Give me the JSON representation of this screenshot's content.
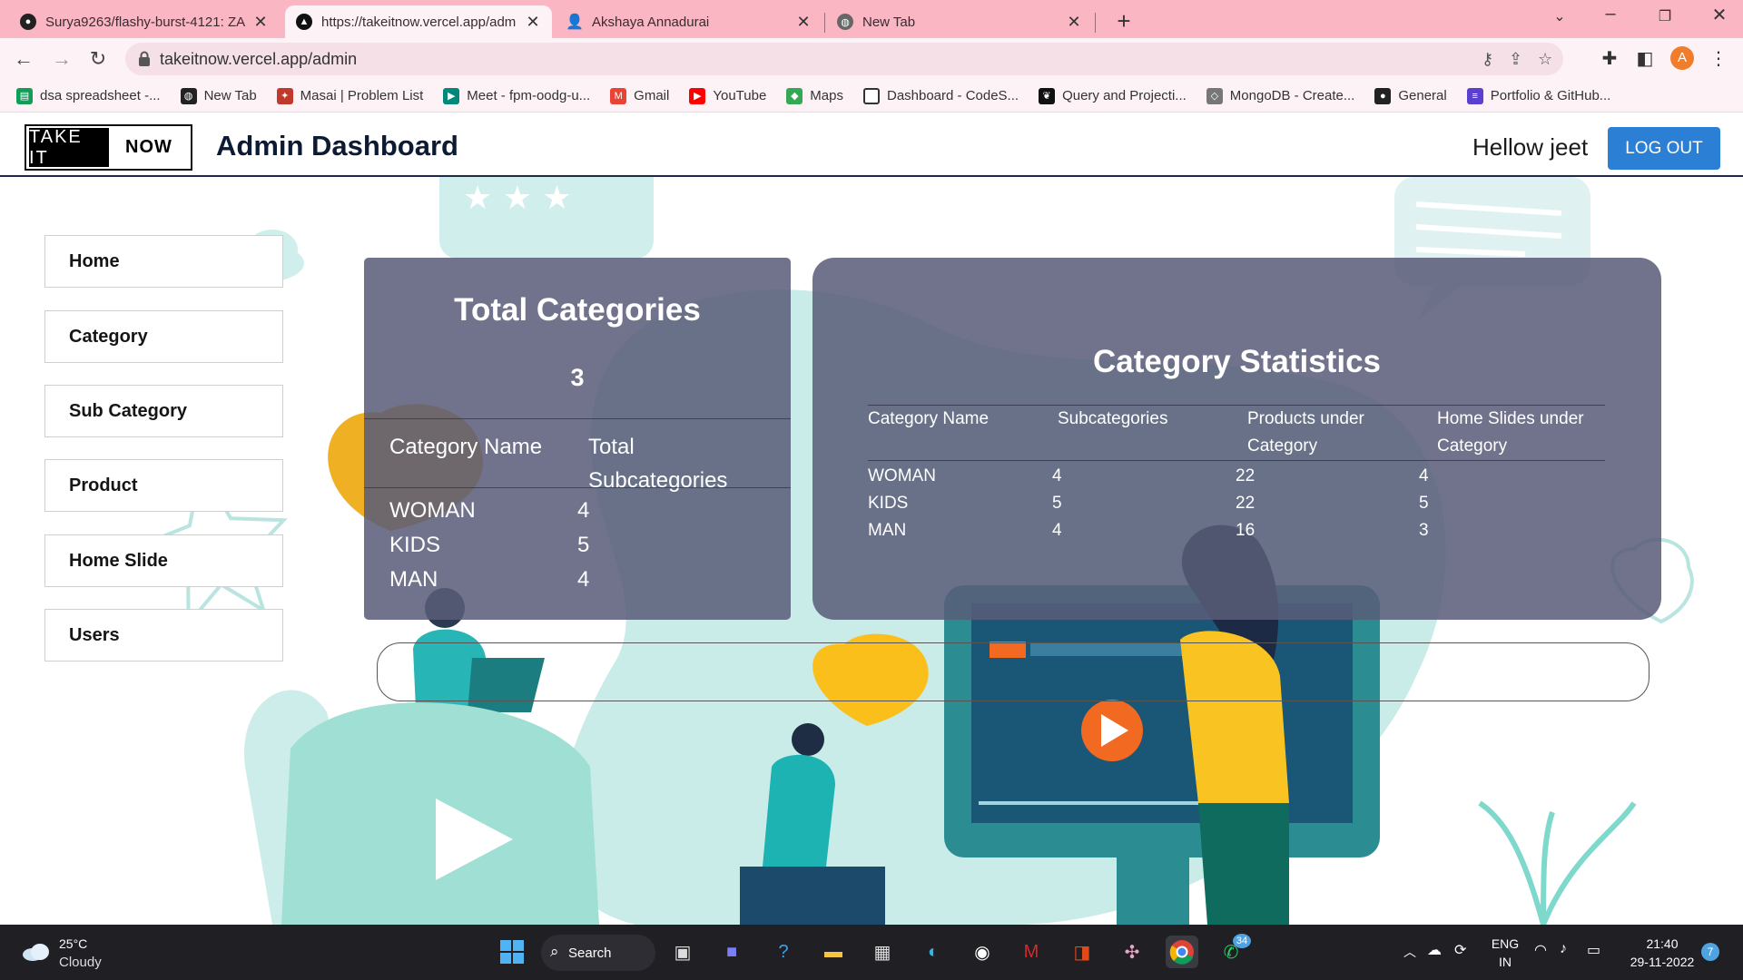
{
  "browser": {
    "tabs": [
      {
        "title": "Surya9263/flashy-burst-4121: ZA",
        "icon": "github-icon",
        "active": false
      },
      {
        "title": "https://takeitnow.vercel.app/adm",
        "icon": "vercel-icon",
        "active": true
      },
      {
        "title": "Akshaya Annadurai",
        "icon": "person-icon",
        "active": false
      },
      {
        "title": "New Tab",
        "icon": "globe-icon",
        "active": false
      }
    ],
    "url": "takeitnow.vercel.app/admin",
    "profile_initial": "A",
    "bookmarks": [
      {
        "label": "dsa spreadsheet -...",
        "icon": "sheets-icon",
        "color": "#0f9d58"
      },
      {
        "label": "New Tab",
        "icon": "globe-icon",
        "color": "#222222"
      },
      {
        "label": "Masai | Problem List",
        "icon": "masai-icon",
        "color": "#c0392b"
      },
      {
        "label": "Meet - fpm-oodg-u...",
        "icon": "meet-icon",
        "color": "#00897b"
      },
      {
        "label": "Gmail",
        "icon": "gmail-icon",
        "color": "#ea4335"
      },
      {
        "label": "YouTube",
        "icon": "youtube-icon",
        "color": "#ff0000"
      },
      {
        "label": "Maps",
        "icon": "maps-icon",
        "color": "#34a853"
      },
      {
        "label": "Dashboard - CodeS...",
        "icon": "square-icon",
        "color": "#ffffff"
      },
      {
        "label": "Query and Projecti...",
        "icon": "mongodb-leaf-icon",
        "color": "#111111"
      },
      {
        "label": "MongoDB - Create...",
        "icon": "diamond-icon",
        "color": "#777777"
      },
      {
        "label": "General",
        "icon": "github-icon",
        "color": "#222222"
      },
      {
        "label": "Portfolio & GitHub...",
        "icon": "list-icon",
        "color": "#5b3fd0"
      }
    ]
  },
  "navbar": {
    "logo_left": "TAKE IT",
    "logo_right": "NOW",
    "title": "Admin Dashboard",
    "greeting": "Hellow jeet",
    "logout_label": "LOG OUT"
  },
  "sidebar": {
    "items": [
      {
        "label": "Home"
      },
      {
        "label": "Category"
      },
      {
        "label": "Sub Category"
      },
      {
        "label": "Product"
      },
      {
        "label": "Home Slide"
      },
      {
        "label": "Users"
      }
    ]
  },
  "total_categories": {
    "title": "Total Categories",
    "count": "3",
    "headers": [
      "Category Name",
      "Total Subcategories"
    ],
    "rows": [
      {
        "name": "WOMAN",
        "subcategories": "4"
      },
      {
        "name": "KIDS",
        "subcategories": "5"
      },
      {
        "name": "MAN",
        "subcategories": "4"
      }
    ]
  },
  "category_statistics": {
    "title": "Category Statistics",
    "headers": [
      "Category Name",
      "Subcategories",
      "Products under Category",
      "Home Slides under Category"
    ],
    "rows": [
      {
        "name": "WOMAN",
        "subcategories": "4",
        "products": "22",
        "slides": "4"
      },
      {
        "name": "KIDS",
        "subcategories": "5",
        "products": "22",
        "slides": "5"
      },
      {
        "name": "MAN",
        "subcategories": "4",
        "products": "16",
        "slides": "3"
      }
    ]
  },
  "taskbar": {
    "temperature": "25°C",
    "weather": "Cloudy",
    "search_label": "Search",
    "language": "ENG",
    "region": "IN",
    "time": "21:40",
    "date": "29-11-2022",
    "whatsapp_badge": "34",
    "notification_count": "7"
  }
}
